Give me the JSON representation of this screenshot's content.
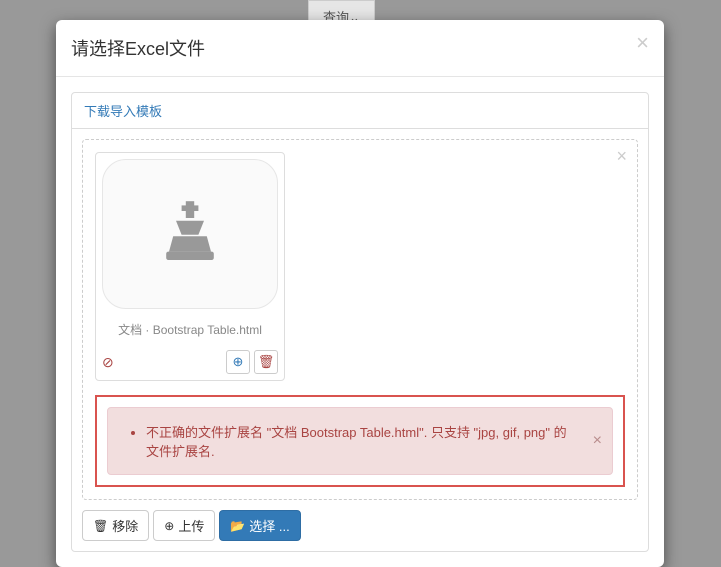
{
  "background": {
    "query_label": "查询"
  },
  "modal": {
    "title": "请选择Excel文件",
    "panel_heading": "下载导入模板",
    "file": {
      "name": "文档 · Bootstrap Table.html"
    },
    "error": "不正确的文件扩展名 \"文档 Bootstrap Table.html\". 只支持 \"jpg, gif, png\" 的文件扩展名.",
    "buttons": {
      "remove": "移除",
      "upload": "上传",
      "select": "选择 ..."
    }
  }
}
